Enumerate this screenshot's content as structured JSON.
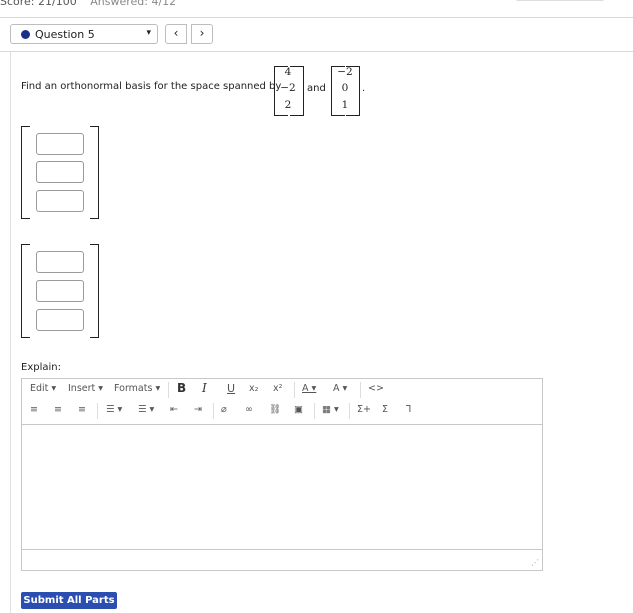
{
  "header": {
    "score": "Score: 21/100",
    "answered": "Answered: 4/12"
  },
  "nav": {
    "question_label": "Question 5",
    "caret": "▾",
    "prev": "‹",
    "next": "›"
  },
  "question": {
    "text": "Find an orthonormal basis for the space spanned by",
    "vector1": [
      "4",
      "−2",
      "2"
    ],
    "connector": "and",
    "vector2": [
      "−2",
      "0",
      "1"
    ],
    "end": "."
  },
  "explain_label": "Explain:",
  "editor": {
    "menu": {
      "edit": "Edit ▾",
      "insert": "Insert ▾",
      "formats": "Formats ▾"
    },
    "format": {
      "bold": "B",
      "italic": "I",
      "underline": "U",
      "subscript": "x₂",
      "superscript": "x²",
      "font_color": "A ▾",
      "bg_color": "A ▾",
      "code": "<>"
    },
    "row2": {
      "align_left": "≡",
      "align_center": "≡",
      "align_right": "≡",
      "bullet_list": "☰ ▾",
      "numbered_list": "☰ ▾",
      "outdent": "⇤",
      "indent": "⇥",
      "attach": "⌀",
      "link": "∞",
      "unlink": "⛓",
      "image": "▣",
      "table": "▦ ▾",
      "equation": "Σ+",
      "sigma": "Σ",
      "handwriting": "Ꞁ"
    },
    "grip": "⋰"
  },
  "submit_label": "Submit All Parts"
}
